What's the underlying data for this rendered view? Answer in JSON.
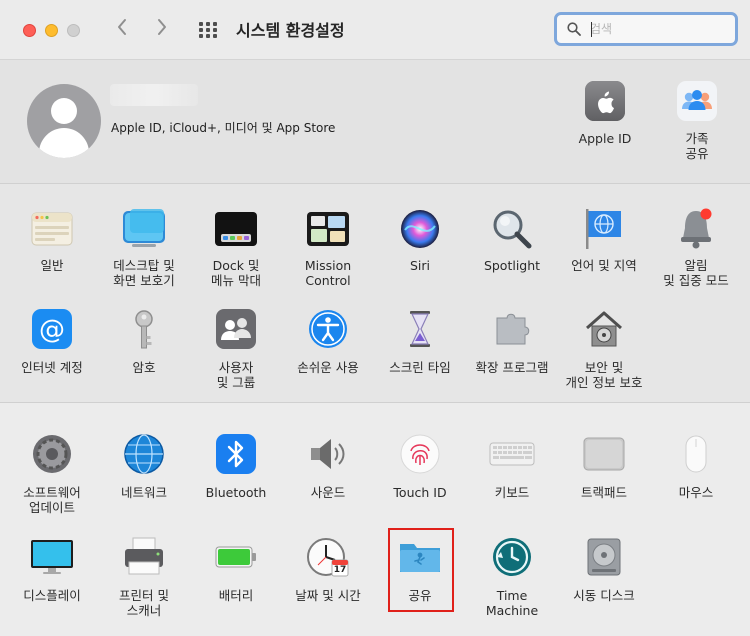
{
  "window": {
    "title": "시스템 환경설정",
    "search_placeholder": "검색"
  },
  "account": {
    "subtitle": "Apple ID, iCloud+, 미디어 및 App Store",
    "apple_id": "Apple ID",
    "family": [
      "가족",
      "공유"
    ]
  },
  "row1": [
    {
      "label": [
        "일반"
      ]
    },
    {
      "label": [
        "데스크탑 및",
        "화면 보호기"
      ]
    },
    {
      "label": [
        "Dock 및",
        "메뉴 막대"
      ]
    },
    {
      "label": [
        "Mission",
        "Control"
      ]
    },
    {
      "label": [
        "Siri"
      ]
    },
    {
      "label": [
        "Spotlight"
      ]
    },
    {
      "label": [
        "언어 및 지역"
      ]
    },
    {
      "label": [
        "알림",
        "및 집중 모드"
      ]
    }
  ],
  "row2": [
    {
      "label": [
        "인터넷 계정"
      ]
    },
    {
      "label": [
        "암호"
      ]
    },
    {
      "label": [
        "사용자",
        "및 그룹"
      ]
    },
    {
      "label": [
        "손쉬운 사용"
      ]
    },
    {
      "label": [
        "스크린 타임"
      ]
    },
    {
      "label": [
        "확장 프로그램"
      ]
    },
    {
      "label": [
        "보안 및",
        "개인 정보 보호"
      ]
    }
  ],
  "row3": [
    {
      "label": [
        "소프트웨어",
        "업데이트"
      ]
    },
    {
      "label": [
        "네트워크"
      ]
    },
    {
      "label": [
        "Bluetooth"
      ]
    },
    {
      "label": [
        "사운드"
      ]
    },
    {
      "label": [
        "Touch ID"
      ]
    },
    {
      "label": [
        "키보드"
      ]
    },
    {
      "label": [
        "트랙패드"
      ]
    },
    {
      "label": [
        "마우스"
      ]
    }
  ],
  "row4": [
    {
      "label": [
        "디스플레이"
      ]
    },
    {
      "label": [
        "프린터 및",
        "스캐너"
      ]
    },
    {
      "label": [
        "배터리"
      ]
    },
    {
      "label": [
        "날짜 및 시간"
      ],
      "cal_day": "17"
    },
    {
      "label": [
        "공유"
      ]
    },
    {
      "label": [
        "Time",
        "Machine"
      ]
    },
    {
      "label": [
        "시동 디스크"
      ]
    }
  ]
}
